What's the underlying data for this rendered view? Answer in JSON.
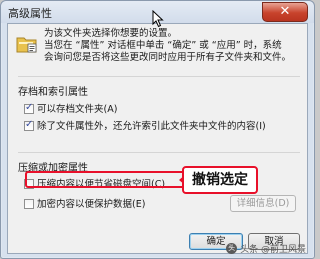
{
  "dialog": {
    "title": "高级属性",
    "close_glyph": "✕",
    "description_line1": "为该文件夹选择你想要的设置。",
    "description_line2": "当您在 “属性” 对话框中单击 “确定” 或 “应用” 时，系统",
    "description_line3": "会询问您是否将这些更改同时应用于所有子文件夹和文件。"
  },
  "archive_group": {
    "title": "存档和索引属性",
    "archive_label": "可以存档文件夹(A)",
    "archive_checked": true,
    "index_label": "除了文件属性外，还允许索引此文件夹中文件的内容(I)",
    "index_checked": true
  },
  "compress_group": {
    "title": "压缩或加密属性",
    "compress_label": "压缩内容以便节省磁盘空间(C)",
    "compress_checked": false,
    "encrypt_label": "加密内容以便保护数据(E)",
    "encrypt_checked": false,
    "details_label": "详细信息(D)"
  },
  "buttons": {
    "ok_label": "确定",
    "cancel_label": "取消"
  },
  "annotation": {
    "callout_text": "撤销选定"
  },
  "watermark": {
    "icon_text": "头",
    "text": "头条 @前卫风景"
  },
  "colors": {
    "annotation_red": "#e8102a",
    "close_button_red": "#c8432c"
  }
}
